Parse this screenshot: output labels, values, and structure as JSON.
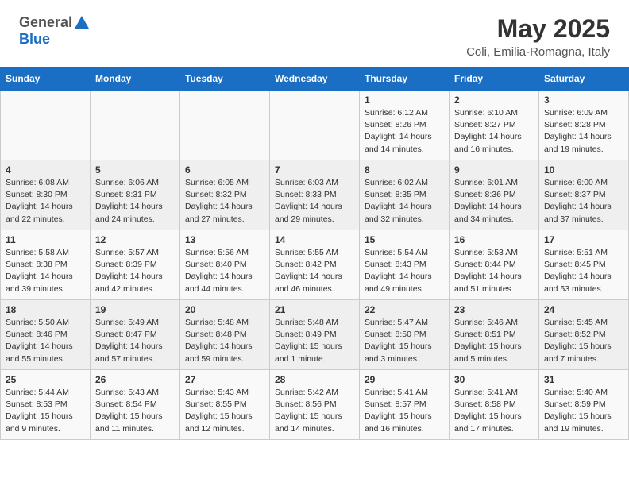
{
  "header": {
    "logo_general": "General",
    "logo_blue": "Blue",
    "title": "May 2025",
    "subtitle": "Coli, Emilia-Romagna, Italy"
  },
  "weekdays": [
    "Sunday",
    "Monday",
    "Tuesday",
    "Wednesday",
    "Thursday",
    "Friday",
    "Saturday"
  ],
  "weeks": [
    [
      {
        "day": "",
        "info": ""
      },
      {
        "day": "",
        "info": ""
      },
      {
        "day": "",
        "info": ""
      },
      {
        "day": "",
        "info": ""
      },
      {
        "day": "1",
        "info": "Sunrise: 6:12 AM\nSunset: 8:26 PM\nDaylight: 14 hours and 14 minutes."
      },
      {
        "day": "2",
        "info": "Sunrise: 6:10 AM\nSunset: 8:27 PM\nDaylight: 14 hours and 16 minutes."
      },
      {
        "day": "3",
        "info": "Sunrise: 6:09 AM\nSunset: 8:28 PM\nDaylight: 14 hours and 19 minutes."
      }
    ],
    [
      {
        "day": "4",
        "info": "Sunrise: 6:08 AM\nSunset: 8:30 PM\nDaylight: 14 hours and 22 minutes."
      },
      {
        "day": "5",
        "info": "Sunrise: 6:06 AM\nSunset: 8:31 PM\nDaylight: 14 hours and 24 minutes."
      },
      {
        "day": "6",
        "info": "Sunrise: 6:05 AM\nSunset: 8:32 PM\nDaylight: 14 hours and 27 minutes."
      },
      {
        "day": "7",
        "info": "Sunrise: 6:03 AM\nSunset: 8:33 PM\nDaylight: 14 hours and 29 minutes."
      },
      {
        "day": "8",
        "info": "Sunrise: 6:02 AM\nSunset: 8:35 PM\nDaylight: 14 hours and 32 minutes."
      },
      {
        "day": "9",
        "info": "Sunrise: 6:01 AM\nSunset: 8:36 PM\nDaylight: 14 hours and 34 minutes."
      },
      {
        "day": "10",
        "info": "Sunrise: 6:00 AM\nSunset: 8:37 PM\nDaylight: 14 hours and 37 minutes."
      }
    ],
    [
      {
        "day": "11",
        "info": "Sunrise: 5:58 AM\nSunset: 8:38 PM\nDaylight: 14 hours and 39 minutes."
      },
      {
        "day": "12",
        "info": "Sunrise: 5:57 AM\nSunset: 8:39 PM\nDaylight: 14 hours and 42 minutes."
      },
      {
        "day": "13",
        "info": "Sunrise: 5:56 AM\nSunset: 8:40 PM\nDaylight: 14 hours and 44 minutes."
      },
      {
        "day": "14",
        "info": "Sunrise: 5:55 AM\nSunset: 8:42 PM\nDaylight: 14 hours and 46 minutes."
      },
      {
        "day": "15",
        "info": "Sunrise: 5:54 AM\nSunset: 8:43 PM\nDaylight: 14 hours and 49 minutes."
      },
      {
        "day": "16",
        "info": "Sunrise: 5:53 AM\nSunset: 8:44 PM\nDaylight: 14 hours and 51 minutes."
      },
      {
        "day": "17",
        "info": "Sunrise: 5:51 AM\nSunset: 8:45 PM\nDaylight: 14 hours and 53 minutes."
      }
    ],
    [
      {
        "day": "18",
        "info": "Sunrise: 5:50 AM\nSunset: 8:46 PM\nDaylight: 14 hours and 55 minutes."
      },
      {
        "day": "19",
        "info": "Sunrise: 5:49 AM\nSunset: 8:47 PM\nDaylight: 14 hours and 57 minutes."
      },
      {
        "day": "20",
        "info": "Sunrise: 5:48 AM\nSunset: 8:48 PM\nDaylight: 14 hours and 59 minutes."
      },
      {
        "day": "21",
        "info": "Sunrise: 5:48 AM\nSunset: 8:49 PM\nDaylight: 15 hours and 1 minute."
      },
      {
        "day": "22",
        "info": "Sunrise: 5:47 AM\nSunset: 8:50 PM\nDaylight: 15 hours and 3 minutes."
      },
      {
        "day": "23",
        "info": "Sunrise: 5:46 AM\nSunset: 8:51 PM\nDaylight: 15 hours and 5 minutes."
      },
      {
        "day": "24",
        "info": "Sunrise: 5:45 AM\nSunset: 8:52 PM\nDaylight: 15 hours and 7 minutes."
      }
    ],
    [
      {
        "day": "25",
        "info": "Sunrise: 5:44 AM\nSunset: 8:53 PM\nDaylight: 15 hours and 9 minutes."
      },
      {
        "day": "26",
        "info": "Sunrise: 5:43 AM\nSunset: 8:54 PM\nDaylight: 15 hours and 11 minutes."
      },
      {
        "day": "27",
        "info": "Sunrise: 5:43 AM\nSunset: 8:55 PM\nDaylight: 15 hours and 12 minutes."
      },
      {
        "day": "28",
        "info": "Sunrise: 5:42 AM\nSunset: 8:56 PM\nDaylight: 15 hours and 14 minutes."
      },
      {
        "day": "29",
        "info": "Sunrise: 5:41 AM\nSunset: 8:57 PM\nDaylight: 15 hours and 16 minutes."
      },
      {
        "day": "30",
        "info": "Sunrise: 5:41 AM\nSunset: 8:58 PM\nDaylight: 15 hours and 17 minutes."
      },
      {
        "day": "31",
        "info": "Sunrise: 5:40 AM\nSunset: 8:59 PM\nDaylight: 15 hours and 19 minutes."
      }
    ]
  ]
}
